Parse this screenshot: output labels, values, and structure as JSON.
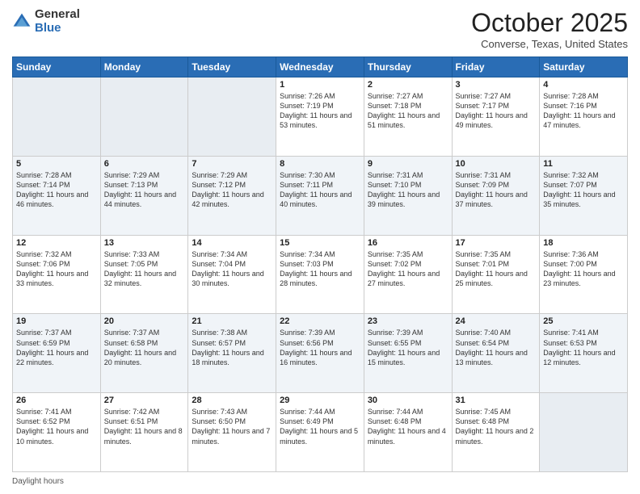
{
  "header": {
    "logo_general": "General",
    "logo_blue": "Blue",
    "month": "October 2025",
    "location": "Converse, Texas, United States"
  },
  "days_of_week": [
    "Sunday",
    "Monday",
    "Tuesday",
    "Wednesday",
    "Thursday",
    "Friday",
    "Saturday"
  ],
  "weeks": [
    [
      {
        "day": "",
        "info": ""
      },
      {
        "day": "",
        "info": ""
      },
      {
        "day": "",
        "info": ""
      },
      {
        "day": "1",
        "info": "Sunrise: 7:26 AM\nSunset: 7:19 PM\nDaylight: 11 hours and 53 minutes."
      },
      {
        "day": "2",
        "info": "Sunrise: 7:27 AM\nSunset: 7:18 PM\nDaylight: 11 hours and 51 minutes."
      },
      {
        "day": "3",
        "info": "Sunrise: 7:27 AM\nSunset: 7:17 PM\nDaylight: 11 hours and 49 minutes."
      },
      {
        "day": "4",
        "info": "Sunrise: 7:28 AM\nSunset: 7:16 PM\nDaylight: 11 hours and 47 minutes."
      }
    ],
    [
      {
        "day": "5",
        "info": "Sunrise: 7:28 AM\nSunset: 7:14 PM\nDaylight: 11 hours and 46 minutes."
      },
      {
        "day": "6",
        "info": "Sunrise: 7:29 AM\nSunset: 7:13 PM\nDaylight: 11 hours and 44 minutes."
      },
      {
        "day": "7",
        "info": "Sunrise: 7:29 AM\nSunset: 7:12 PM\nDaylight: 11 hours and 42 minutes."
      },
      {
        "day": "8",
        "info": "Sunrise: 7:30 AM\nSunset: 7:11 PM\nDaylight: 11 hours and 40 minutes."
      },
      {
        "day": "9",
        "info": "Sunrise: 7:31 AM\nSunset: 7:10 PM\nDaylight: 11 hours and 39 minutes."
      },
      {
        "day": "10",
        "info": "Sunrise: 7:31 AM\nSunset: 7:09 PM\nDaylight: 11 hours and 37 minutes."
      },
      {
        "day": "11",
        "info": "Sunrise: 7:32 AM\nSunset: 7:07 PM\nDaylight: 11 hours and 35 minutes."
      }
    ],
    [
      {
        "day": "12",
        "info": "Sunrise: 7:32 AM\nSunset: 7:06 PM\nDaylight: 11 hours and 33 minutes."
      },
      {
        "day": "13",
        "info": "Sunrise: 7:33 AM\nSunset: 7:05 PM\nDaylight: 11 hours and 32 minutes."
      },
      {
        "day": "14",
        "info": "Sunrise: 7:34 AM\nSunset: 7:04 PM\nDaylight: 11 hours and 30 minutes."
      },
      {
        "day": "15",
        "info": "Sunrise: 7:34 AM\nSunset: 7:03 PM\nDaylight: 11 hours and 28 minutes."
      },
      {
        "day": "16",
        "info": "Sunrise: 7:35 AM\nSunset: 7:02 PM\nDaylight: 11 hours and 27 minutes."
      },
      {
        "day": "17",
        "info": "Sunrise: 7:35 AM\nSunset: 7:01 PM\nDaylight: 11 hours and 25 minutes."
      },
      {
        "day": "18",
        "info": "Sunrise: 7:36 AM\nSunset: 7:00 PM\nDaylight: 11 hours and 23 minutes."
      }
    ],
    [
      {
        "day": "19",
        "info": "Sunrise: 7:37 AM\nSunset: 6:59 PM\nDaylight: 11 hours and 22 minutes."
      },
      {
        "day": "20",
        "info": "Sunrise: 7:37 AM\nSunset: 6:58 PM\nDaylight: 11 hours and 20 minutes."
      },
      {
        "day": "21",
        "info": "Sunrise: 7:38 AM\nSunset: 6:57 PM\nDaylight: 11 hours and 18 minutes."
      },
      {
        "day": "22",
        "info": "Sunrise: 7:39 AM\nSunset: 6:56 PM\nDaylight: 11 hours and 16 minutes."
      },
      {
        "day": "23",
        "info": "Sunrise: 7:39 AM\nSunset: 6:55 PM\nDaylight: 11 hours and 15 minutes."
      },
      {
        "day": "24",
        "info": "Sunrise: 7:40 AM\nSunset: 6:54 PM\nDaylight: 11 hours and 13 minutes."
      },
      {
        "day": "25",
        "info": "Sunrise: 7:41 AM\nSunset: 6:53 PM\nDaylight: 11 hours and 12 minutes."
      }
    ],
    [
      {
        "day": "26",
        "info": "Sunrise: 7:41 AM\nSunset: 6:52 PM\nDaylight: 11 hours and 10 minutes."
      },
      {
        "day": "27",
        "info": "Sunrise: 7:42 AM\nSunset: 6:51 PM\nDaylight: 11 hours and 8 minutes."
      },
      {
        "day": "28",
        "info": "Sunrise: 7:43 AM\nSunset: 6:50 PM\nDaylight: 11 hours and 7 minutes."
      },
      {
        "day": "29",
        "info": "Sunrise: 7:44 AM\nSunset: 6:49 PM\nDaylight: 11 hours and 5 minutes."
      },
      {
        "day": "30",
        "info": "Sunrise: 7:44 AM\nSunset: 6:48 PM\nDaylight: 11 hours and 4 minutes."
      },
      {
        "day": "31",
        "info": "Sunrise: 7:45 AM\nSunset: 6:48 PM\nDaylight: 11 hours and 2 minutes."
      },
      {
        "day": "",
        "info": ""
      }
    ]
  ],
  "footer": {
    "daylight_label": "Daylight hours"
  }
}
